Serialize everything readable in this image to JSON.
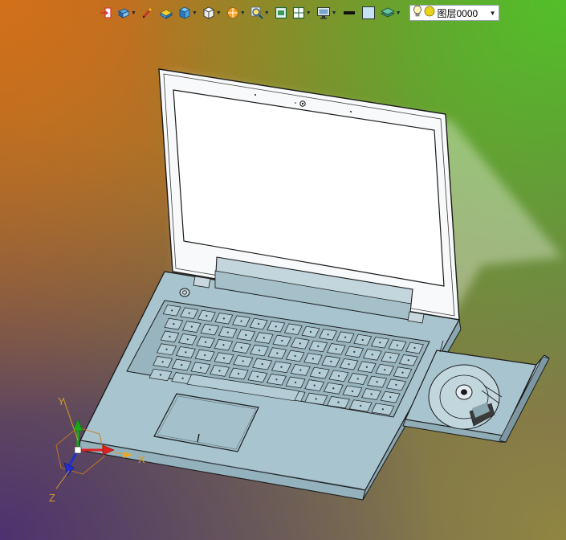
{
  "toolbar": {
    "items": [
      {
        "icon": "import-arrow-icon",
        "dropdown": false
      },
      {
        "icon": "render-mode-icon",
        "dropdown": true
      },
      {
        "icon": "pencil-sketch-icon",
        "dropdown": false
      },
      {
        "icon": "shaded-solid-icon",
        "dropdown": false
      },
      {
        "icon": "view-cube-icon",
        "dropdown": true
      },
      {
        "icon": "wireframe-cube-icon",
        "dropdown": true
      },
      {
        "icon": "section-ball-icon",
        "dropdown": true
      },
      {
        "icon": "zoom-view-icon",
        "dropdown": true
      },
      {
        "icon": "fit-view-icon",
        "dropdown": false
      },
      {
        "icon": "split-view-icon",
        "dropdown": true
      },
      {
        "icon": "monitor-display-icon",
        "dropdown": true
      },
      {
        "icon": "line-color-icon",
        "dropdown": false
      },
      {
        "icon": "fill-color-icon",
        "dropdown": false
      },
      {
        "icon": "layer-stack-icon",
        "dropdown": true
      }
    ],
    "layer": {
      "name": "图层0000",
      "icons": [
        "lightbulb-icon",
        "layer-color-icon"
      ],
      "colors": {
        "bulb": "#fff7b0",
        "swatch": "#e8d21a"
      }
    }
  },
  "axes": {
    "x_label": "X",
    "y_label": "Y",
    "z_label": "Z",
    "colors": {
      "x": "#e02020",
      "y": "#18a818",
      "z": "#2030d0",
      "label": "#d79a2a"
    }
  },
  "scene": {
    "model": "laptop",
    "colors": {
      "body": "#a8c4cf",
      "screen": "#ffffff",
      "outline": "#1a1a1a"
    }
  }
}
